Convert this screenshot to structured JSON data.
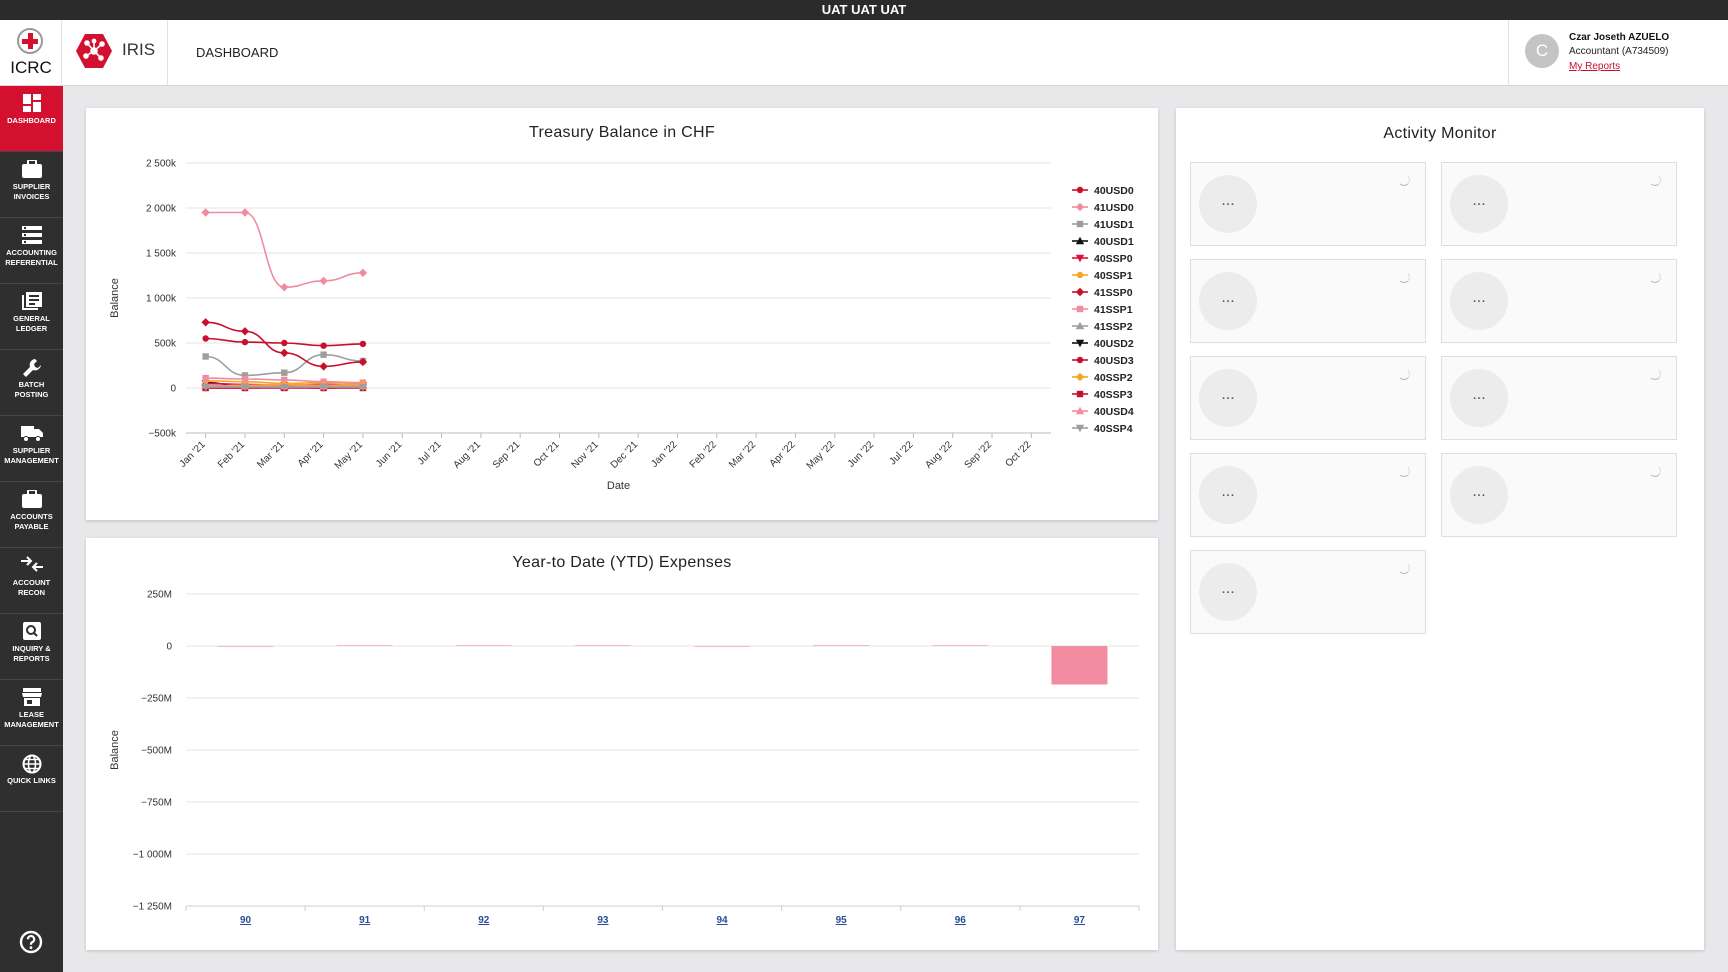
{
  "env_banner": "UAT UAT UAT",
  "header": {
    "org_name": "ICRC",
    "app_name": "IRIS",
    "page_label": "DASHBOARD",
    "user": {
      "avatar_initial": "C",
      "name": "Czar Joseth AZUELO",
      "role": "Accountant (A734509)",
      "reports_link": "My Reports"
    }
  },
  "sidebar": {
    "items": [
      {
        "label": "DASHBOARD",
        "icon": "dashboard-icon",
        "active": true
      },
      {
        "label": "SUPPLIER INVOICES",
        "icon": "briefcase-icon"
      },
      {
        "label": "ACCOUNTING REFERENTIAL",
        "icon": "list-icon"
      },
      {
        "label": "GENERAL LEDGER",
        "icon": "ledger-icon"
      },
      {
        "label": "BATCH POSTING",
        "icon": "wrench-icon"
      },
      {
        "label": "SUPPLIER MANAGEMENT",
        "icon": "truck-icon"
      },
      {
        "label": "ACCOUNTS PAYABLE",
        "icon": "briefcase-icon"
      },
      {
        "label": "ACCOUNT RECON",
        "icon": "reconcile-icon"
      },
      {
        "label": "INQUIRY & REPORTS",
        "icon": "search-icon"
      },
      {
        "label": "LEASE MANAGEMENT",
        "icon": "store-icon"
      },
      {
        "label": "QUICK LINKS",
        "icon": "globe-icon"
      }
    ],
    "help_icon": "help-icon"
  },
  "colors": {
    "brand_red": "#d3102e",
    "sidebar_bg": "#2f2f2f"
  },
  "treasury": {
    "title": "Treasury Balance in CHF",
    "xlabel": "Date",
    "ylabel": "Balance"
  },
  "ytd": {
    "title": "Year-to Date (YTD) Expenses",
    "ylabel": "Balance"
  },
  "activity": {
    "title": "Activity Monitor",
    "tiles": [
      "...",
      "...",
      "...",
      "...",
      "...",
      "...",
      "...",
      "...",
      "..."
    ]
  },
  "chart_data": [
    {
      "type": "line",
      "title": "Treasury Balance in CHF",
      "xlabel": "Date",
      "ylabel": "Balance",
      "x": [
        "Jan '21",
        "Feb '21",
        "Mar '21",
        "Apr '21",
        "May '21",
        "Jun '21",
        "Jul '21",
        "Aug '21",
        "Sep '21",
        "Oct '21",
        "Nov '21",
        "Dec '21",
        "Jan '22",
        "Feb '22",
        "Mar '22",
        "Apr '22",
        "May '22",
        "Jun '22",
        "Jul '22",
        "Aug '22",
        "Sep '22",
        "Oct '22"
      ],
      "yticks": [
        -500000,
        0,
        500000,
        1000000,
        1500000,
        2000000,
        2500000
      ],
      "ytick_labels": [
        "−500k",
        "0",
        "500k",
        "1 000k",
        "1 500k",
        "2 000k",
        "2 500k"
      ],
      "ylim": [
        -500000,
        2500000
      ],
      "grid": true,
      "legend_position": "right",
      "series": [
        {
          "name": "40USD0",
          "color": "#c8102e",
          "marker": "circle",
          "values": [
            550000,
            510000,
            500000,
            470000,
            490000
          ]
        },
        {
          "name": "41USD0",
          "color": "#f08ca0",
          "marker": "diamond",
          "values": [
            1950000,
            1950000,
            1120000,
            1190000,
            1280000
          ]
        },
        {
          "name": "41USD1",
          "color": "#9e9e9e",
          "marker": "square",
          "values": [
            350000,
            140000,
            170000,
            370000,
            300000
          ]
        },
        {
          "name": "40USD1",
          "color": "#111111",
          "marker": "triangle",
          "values": [
            60000,
            20000,
            10000,
            20000,
            30000
          ]
        },
        {
          "name": "40SSP0",
          "color": "#e0103a",
          "marker": "triangle-down",
          "values": [
            50000,
            40000,
            30000,
            40000,
            30000
          ]
        },
        {
          "name": "40SSP1",
          "color": "#f5a623",
          "marker": "circle",
          "values": [
            80000,
            70000,
            50000,
            60000,
            50000
          ]
        },
        {
          "name": "41SSP0",
          "color": "#c8102e",
          "marker": "diamond",
          "values": [
            730000,
            630000,
            390000,
            240000,
            290000
          ]
        },
        {
          "name": "41SSP1",
          "color": "#f08ca0",
          "marker": "square",
          "values": [
            110000,
            100000,
            90000,
            70000,
            60000
          ]
        },
        {
          "name": "41SSP2",
          "color": "#9e9e9e",
          "marker": "triangle",
          "values": [
            20000,
            30000,
            20000,
            30000,
            30000
          ]
        },
        {
          "name": "40USD2",
          "color": "#111111",
          "marker": "triangle-down",
          "values": [
            10000,
            10000,
            10000,
            10000,
            10000
          ]
        },
        {
          "name": "40USD3",
          "color": "#c8102e",
          "marker": "circle",
          "values": [
            0,
            0,
            10000,
            0,
            10000
          ]
        },
        {
          "name": "40SSP2",
          "color": "#f5a623",
          "marker": "diamond",
          "values": [
            20000,
            30000,
            40000,
            30000,
            40000
          ]
        },
        {
          "name": "40SSP3",
          "color": "#c8102e",
          "marker": "square",
          "values": [
            0,
            0,
            0,
            0,
            0
          ]
        },
        {
          "name": "40USD4",
          "color": "#f08ca0",
          "marker": "triangle",
          "values": [
            30000,
            20000,
            20000,
            20000,
            20000
          ]
        },
        {
          "name": "40SSP4",
          "color": "#9e9e9e",
          "marker": "triangle-down",
          "values": [
            10000,
            10000,
            10000,
            10000,
            10000
          ]
        }
      ]
    },
    {
      "type": "bar",
      "title": "Year-to Date (YTD) Expenses",
      "ylabel": "Balance",
      "categories": [
        "90",
        "91",
        "92",
        "93",
        "94",
        "95",
        "96",
        "97"
      ],
      "values": [
        -2000,
        0,
        3000,
        0,
        -2000,
        0,
        0,
        -185000000
      ],
      "bar_color": "#f28ca0",
      "yticks": [
        250000000,
        0,
        -250000000,
        -500000000,
        -750000000,
        -1000000000,
        -1250000000
      ],
      "ytick_labels": [
        "250M",
        "0",
        "−250M",
        "−500M",
        "−750M",
        "−1 000M",
        "−1 250M"
      ],
      "ylim": [
        -1250000000,
        250000000
      ],
      "grid": true
    }
  ]
}
